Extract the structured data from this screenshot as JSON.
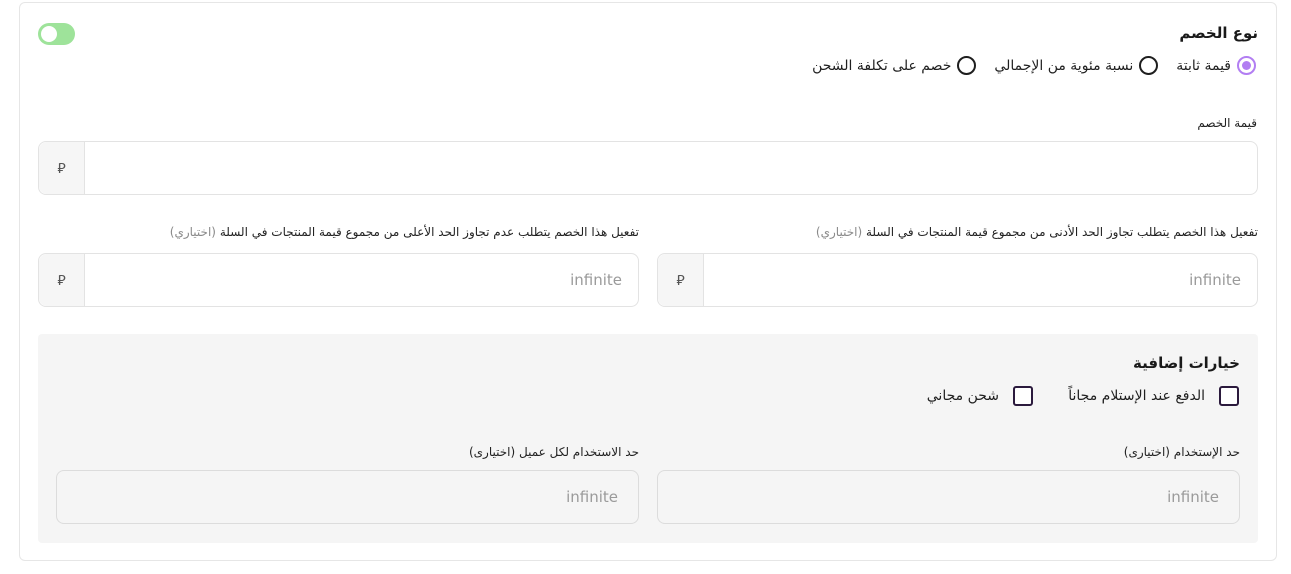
{
  "discount_type": {
    "title": "نوع الخصم",
    "enabled": true,
    "options": [
      {
        "label": "قيمة ثابتة",
        "selected": true
      },
      {
        "label": "نسبة مئوية من الإجمالي",
        "selected": false
      },
      {
        "label": "خصم على تكلفة الشحن",
        "selected": false
      }
    ]
  },
  "discount_value": {
    "label": "قيمة الخصم",
    "value": "",
    "currency_symbol": "⃁"
  },
  "min_total": {
    "label": "تفعيل هذا الخصم يتطلب تجاوز الحد الأدنى من مجموع قيمة المنتجات في السلة",
    "optional": "(اختياري)",
    "placeholder": "infinite",
    "currency_symbol": "⃁"
  },
  "max_total": {
    "label": "تفعيل هذا الخصم يتطلب عدم تجاوز الحد الأعلى من مجموع قيمة المنتجات في السلة",
    "optional": "(اختياري)",
    "placeholder": "infinite",
    "currency_symbol": "⃁"
  },
  "extra_options": {
    "title": "خيارات إضافية",
    "checkboxes": [
      {
        "label": "الدفع عند الإستلام مجاناً",
        "checked": false
      },
      {
        "label": "شحن مجاني",
        "checked": false
      }
    ],
    "usage_limit": {
      "label": "حد الإستخدام (اختيارى)",
      "placeholder": "infinite"
    },
    "per_customer_limit": {
      "label": "حد الاستخدام لكل عميل (اختيارى)",
      "placeholder": "infinite"
    }
  },
  "colors": {
    "accent": "#b27ef2",
    "toggle_on": "#9ee39a",
    "panel_bg": "#f5f5f5"
  }
}
